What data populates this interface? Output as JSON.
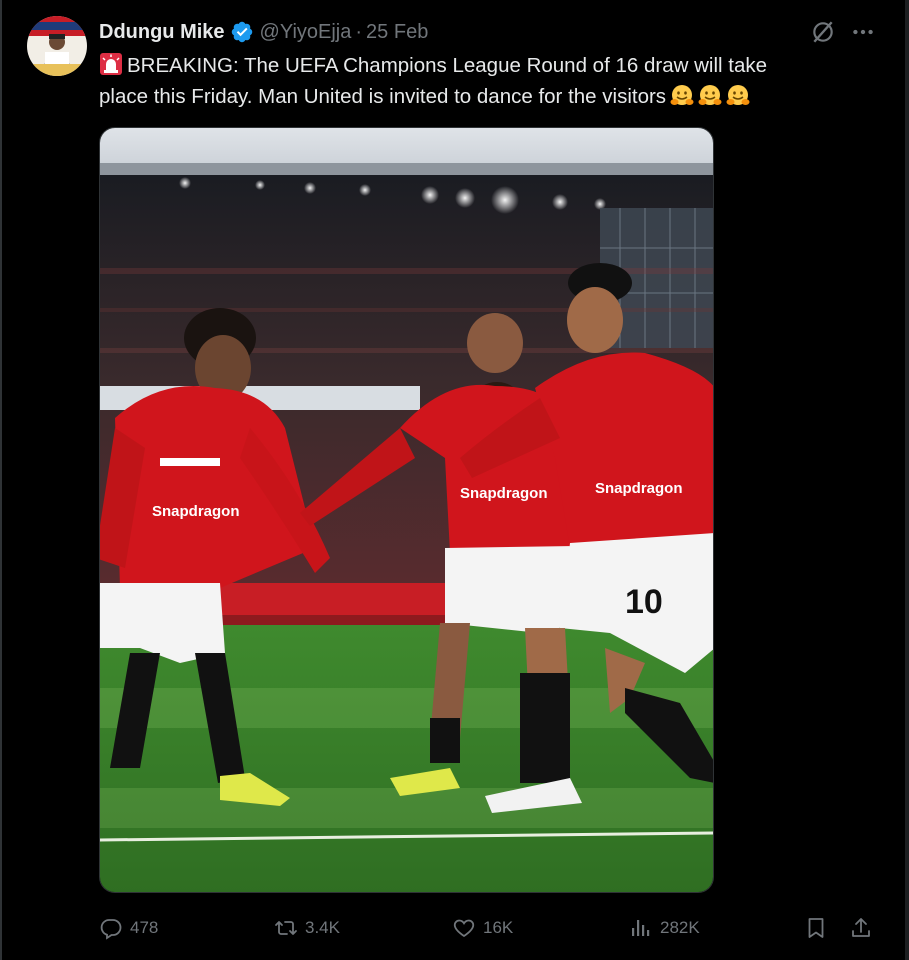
{
  "author": {
    "display_name": "Ddungu Mike",
    "handle": "@YiyoEjja",
    "separator": "·",
    "date": "25 Feb"
  },
  "tweet": {
    "text_line1": "BREAKING: The UEFA Champions League Round of 16 draw will take",
    "text_line2": "place this Friday. Man United is invited to dance for the visitors"
  },
  "media": {
    "shirt_sponsor": "Snapdragon",
    "shirt_number": "10"
  },
  "actions": {
    "replies": "478",
    "reposts": "3.4K",
    "likes": "16K",
    "views": "282K"
  },
  "icons": {
    "reply": "reply-icon",
    "repost": "repost-icon",
    "like": "heart-icon",
    "views": "views-icon",
    "bookmark": "bookmark-icon",
    "share": "share-icon",
    "more": "more-icon",
    "grok": "grok-icon",
    "verified": "verified-badge-icon"
  },
  "colors": {
    "background": "#000000",
    "primary_text": "#e7e9ea",
    "secondary_text": "#71767b",
    "verified_blue": "#1d9bf0",
    "united_red": "#d0151c"
  }
}
